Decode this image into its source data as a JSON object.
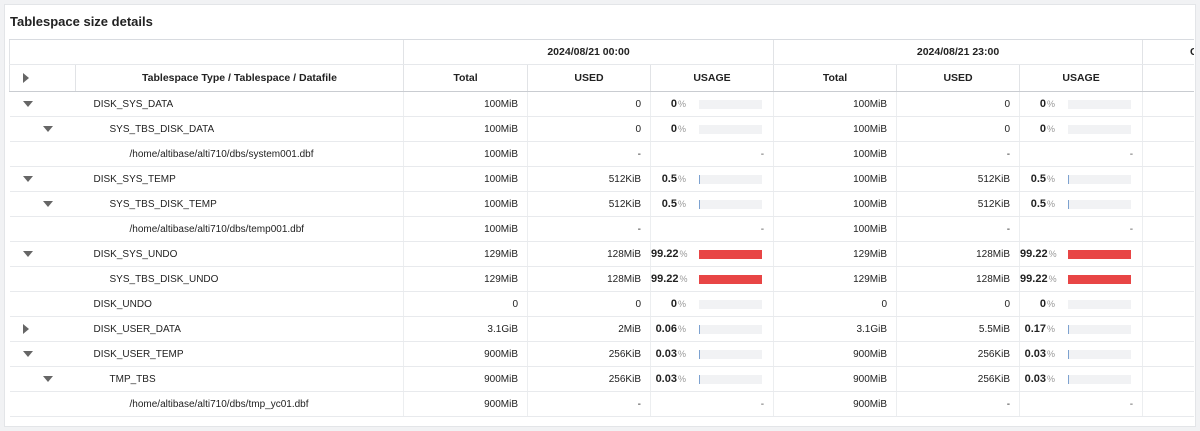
{
  "panel_title": "Tablespace size details",
  "group_headers": [
    "2024/08/21 00:00",
    "2024/08/21 23:00",
    "Chang"
  ],
  "columns": {
    "name": "Tablespace Type / Tablespace / Datafile",
    "total": "Total",
    "used": "USED",
    "usage": "USAGE"
  },
  "percent_sign": "%",
  "colors": {
    "bar_high": "#e84545",
    "bar_low": "#7da2d0",
    "bar_bg": "#f1f2f4"
  },
  "rows": [
    {
      "name": "DISK_SYS_DATA",
      "level": 0,
      "toggle": "expanded",
      "t1": {
        "total": "100MiB",
        "used": "0",
        "usage": "0",
        "fill": 0
      },
      "t2": {
        "total": "100MiB",
        "used": "0",
        "usage": "0",
        "fill": 0
      }
    },
    {
      "name": "SYS_TBS_DISK_DATA",
      "level": 1,
      "toggle": "expanded",
      "t1": {
        "total": "100MiB",
        "used": "0",
        "usage": "0",
        "fill": 0
      },
      "t2": {
        "total": "100MiB",
        "used": "0",
        "usage": "0",
        "fill": 0
      }
    },
    {
      "name": "/home/altibase/alti710/dbs/system001.dbf",
      "level": 2,
      "toggle": "none",
      "t1": {
        "total": "100MiB",
        "used": "-",
        "usage": "-",
        "fill": null
      },
      "t2": {
        "total": "100MiB",
        "used": "-",
        "usage": "-",
        "fill": null
      }
    },
    {
      "name": "DISK_SYS_TEMP",
      "level": 0,
      "toggle": "expanded",
      "t1": {
        "total": "100MiB",
        "used": "512KiB",
        "usage": "0.5",
        "fill": 0.005
      },
      "t2": {
        "total": "100MiB",
        "used": "512KiB",
        "usage": "0.5",
        "fill": 0.005
      }
    },
    {
      "name": "SYS_TBS_DISK_TEMP",
      "level": 1,
      "toggle": "expanded",
      "t1": {
        "total": "100MiB",
        "used": "512KiB",
        "usage": "0.5",
        "fill": 0.005
      },
      "t2": {
        "total": "100MiB",
        "used": "512KiB",
        "usage": "0.5",
        "fill": 0.005
      }
    },
    {
      "name": "/home/altibase/alti710/dbs/temp001.dbf",
      "level": 2,
      "toggle": "none",
      "t1": {
        "total": "100MiB",
        "used": "-",
        "usage": "-",
        "fill": null
      },
      "t2": {
        "total": "100MiB",
        "used": "-",
        "usage": "-",
        "fill": null
      }
    },
    {
      "name": "DISK_SYS_UNDO",
      "level": 0,
      "toggle": "expanded",
      "t1": {
        "total": "129MiB",
        "used": "128MiB",
        "usage": "99.22",
        "fill": 0.9922
      },
      "t2": {
        "total": "129MiB",
        "used": "128MiB",
        "usage": "99.22",
        "fill": 0.9922
      }
    },
    {
      "name": "SYS_TBS_DISK_UNDO",
      "level": 1,
      "toggle": "none",
      "t1": {
        "total": "129MiB",
        "used": "128MiB",
        "usage": "99.22",
        "fill": 0.9922
      },
      "t2": {
        "total": "129MiB",
        "used": "128MiB",
        "usage": "99.22",
        "fill": 0.9922
      }
    },
    {
      "name": "DISK_UNDO",
      "level": 0,
      "toggle": "none",
      "t1": {
        "total": "0",
        "used": "0",
        "usage": "0",
        "fill": 0
      },
      "t2": {
        "total": "0",
        "used": "0",
        "usage": "0",
        "fill": 0
      }
    },
    {
      "name": "DISK_USER_DATA",
      "level": 0,
      "toggle": "collapsed",
      "t1": {
        "total": "3.1GiB",
        "used": "2MiB",
        "usage": "0.06",
        "fill": 0.0006
      },
      "t2": {
        "total": "3.1GiB",
        "used": "5.5MiB",
        "usage": "0.17",
        "fill": 0.0017
      }
    },
    {
      "name": "DISK_USER_TEMP",
      "level": 0,
      "toggle": "expanded",
      "t1": {
        "total": "900MiB",
        "used": "256KiB",
        "usage": "0.03",
        "fill": 0.0003
      },
      "t2": {
        "total": "900MiB",
        "used": "256KiB",
        "usage": "0.03",
        "fill": 0.0003
      }
    },
    {
      "name": "TMP_TBS",
      "level": 1,
      "toggle": "expanded",
      "t1": {
        "total": "900MiB",
        "used": "256KiB",
        "usage": "0.03",
        "fill": 0.0003
      },
      "t2": {
        "total": "900MiB",
        "used": "256KiB",
        "usage": "0.03",
        "fill": 0.0003
      }
    },
    {
      "name": "/home/altibase/alti710/dbs/tmp_yc01.dbf",
      "level": 2,
      "toggle": "none",
      "t1": {
        "total": "900MiB",
        "used": "-",
        "usage": "-",
        "fill": null
      },
      "t2": {
        "total": "900MiB",
        "used": "-",
        "usage": "-",
        "fill": null
      }
    }
  ]
}
